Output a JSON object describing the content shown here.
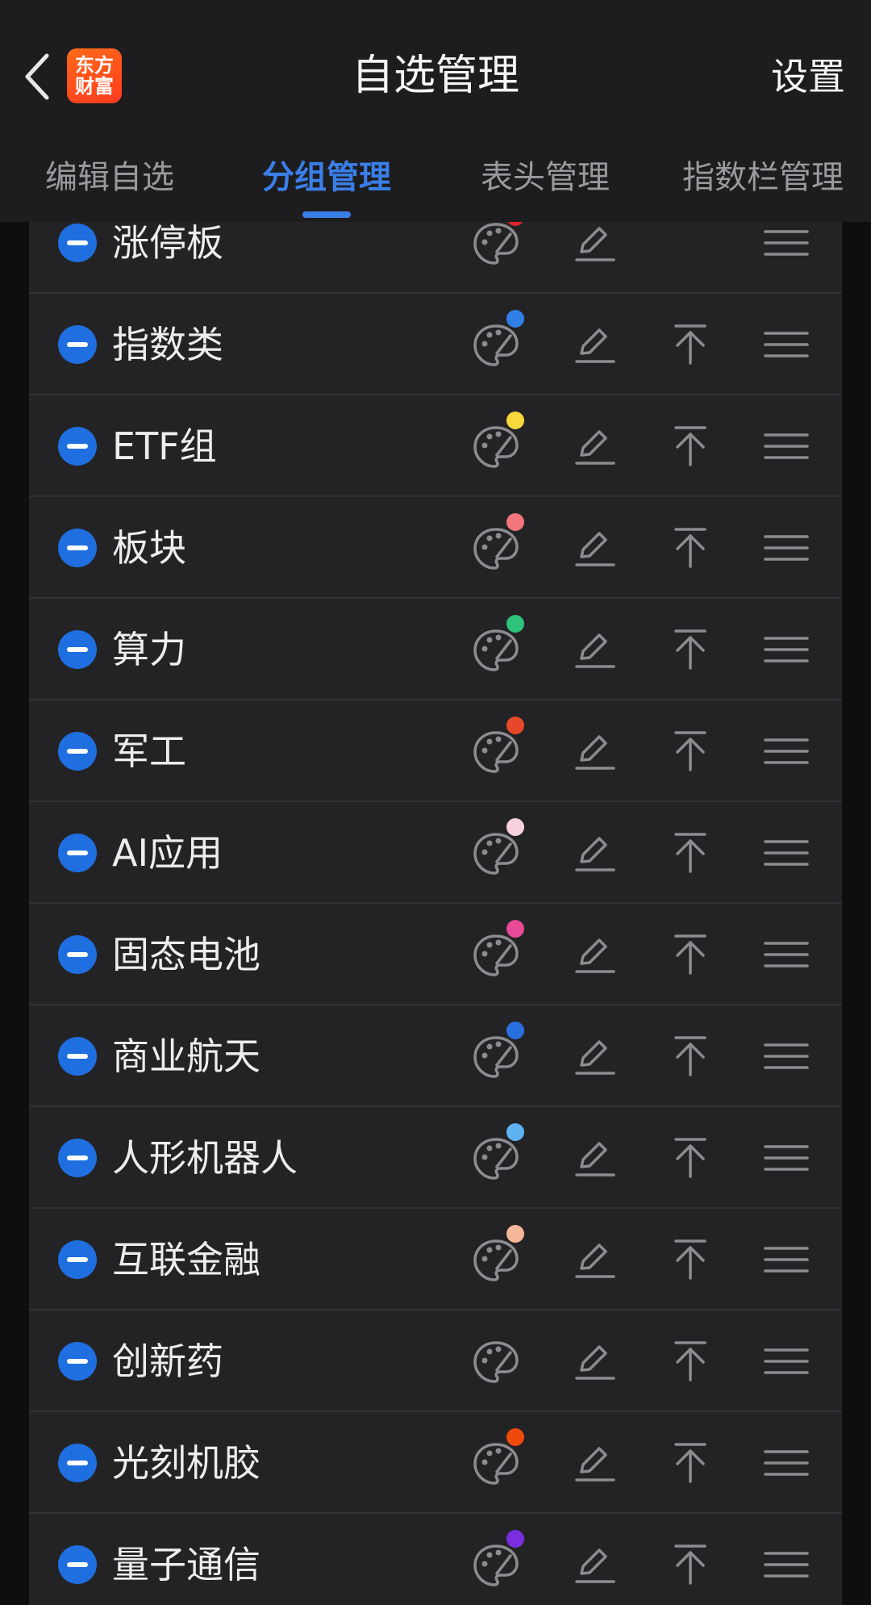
{
  "header": {
    "title": "自选管理",
    "settings_label": "设置",
    "logo_line1": "东方",
    "logo_line2": "财富"
  },
  "tabs": [
    {
      "label": "编辑自选",
      "active": false
    },
    {
      "label": "分组管理",
      "active": true
    },
    {
      "label": "表头管理",
      "active": false
    },
    {
      "label": "指数栏管理",
      "active": false
    }
  ],
  "colors": {
    "accent": "#3a7ee8",
    "remove_button": "#1f6fe0",
    "background": "#232326",
    "header": "#1d1d1f"
  },
  "groups": [
    {
      "name": "涨停板",
      "color": "#e0242c",
      "can_pin_top": false
    },
    {
      "name": "指数类",
      "color": "#2f7fe6",
      "can_pin_top": true
    },
    {
      "name": "ETF组",
      "color": "#f8d83c",
      "can_pin_top": true
    },
    {
      "name": "板块",
      "color": "#f2767a",
      "can_pin_top": true
    },
    {
      "name": "算力",
      "color": "#2ec27a",
      "can_pin_top": true
    },
    {
      "name": "军工",
      "color": "#e8482a",
      "can_pin_top": true
    },
    {
      "name": "AI应用",
      "color": "#f7d2de",
      "can_pin_top": true
    },
    {
      "name": "固态电池",
      "color": "#e84a98",
      "can_pin_top": true
    },
    {
      "name": "商业航天",
      "color": "#2a6fe0",
      "can_pin_top": true
    },
    {
      "name": "人形机器人",
      "color": "#5fb2f2",
      "can_pin_top": true
    },
    {
      "name": "互联金融",
      "color": "#f6b69a",
      "can_pin_top": true
    },
    {
      "name": "创新药",
      "color": "",
      "can_pin_top": true
    },
    {
      "name": "光刻机胶",
      "color": "#f04a0a",
      "can_pin_top": true
    },
    {
      "name": "量子通信",
      "color": "#7a2ee0",
      "can_pin_top": true
    }
  ],
  "icons": {
    "remove": "minus-circle-icon",
    "color": "palette-icon",
    "rename": "pencil-icon",
    "pin_top": "arrow-to-top-icon",
    "reorder": "drag-handle-icon"
  }
}
